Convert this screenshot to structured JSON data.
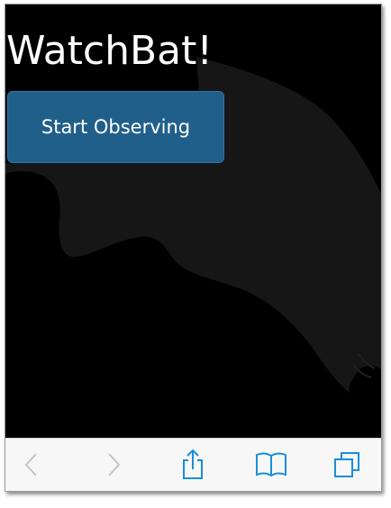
{
  "app": {
    "title": "WatchBat!",
    "start_button_label": "Start Observing"
  },
  "colors": {
    "background": "#000000",
    "bat_silhouette": "#161616",
    "button_fill": "#205f8a",
    "toolbar_background": "#f7f7f7",
    "toolbar_icon_active": "#1a8fd8",
    "toolbar_icon_disabled": "#c4c4c4"
  },
  "toolbar": {
    "buttons": [
      {
        "icon": "back-arrow-icon",
        "state": "disabled"
      },
      {
        "icon": "forward-arrow-icon",
        "state": "disabled"
      },
      {
        "icon": "share-icon",
        "state": "enabled"
      },
      {
        "icon": "bookmarks-icon",
        "state": "enabled"
      },
      {
        "icon": "tabs-icon",
        "state": "enabled"
      }
    ]
  }
}
